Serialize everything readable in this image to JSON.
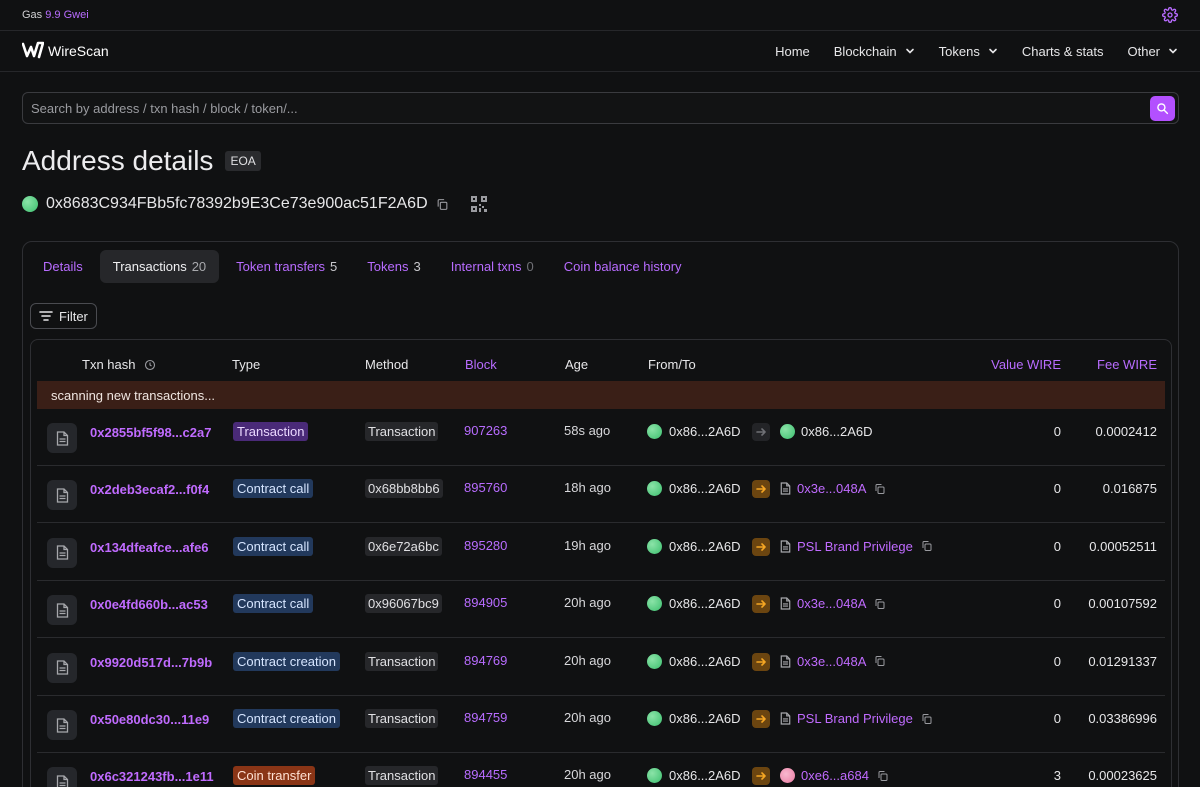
{
  "topbar": {
    "gas_label": "Gas",
    "gas_value": "9.9 Gwei"
  },
  "brand": {
    "name": "WireScan"
  },
  "nav": [
    {
      "label": "Home",
      "dropdown": false
    },
    {
      "label": "Blockchain",
      "dropdown": true
    },
    {
      "label": "Tokens",
      "dropdown": true
    },
    {
      "label": "Charts & stats",
      "dropdown": false
    },
    {
      "label": "Other",
      "dropdown": true
    }
  ],
  "search": {
    "placeholder": "Search by address / txn hash / block / token/..."
  },
  "page": {
    "title": "Address details",
    "badge": "EOA",
    "address": "0x8683C934FBb5fc78392b9E3Ce73e900ac51F2A6D"
  },
  "tabs": [
    {
      "label": "Details",
      "count": ""
    },
    {
      "label": "Transactions",
      "count": "20",
      "active": true
    },
    {
      "label": "Token transfers",
      "count": "5"
    },
    {
      "label": "Tokens",
      "count": "3"
    },
    {
      "label": "Internal txns",
      "count": "0"
    },
    {
      "label": "Coin balance history",
      "count": ""
    }
  ],
  "filter_label": "Filter",
  "table": {
    "headers": {
      "txn_hash": "Txn hash",
      "type": "Type",
      "method": "Method",
      "block": "Block",
      "age": "Age",
      "from_to": "From/To",
      "value": "Value WIRE",
      "fee": "Fee WIRE"
    },
    "scanning_text": "scanning new transactions...",
    "rows": [
      {
        "hash": "0x2855bf5f98...c2a7",
        "type": "Transaction",
        "type_kind": "tx",
        "method": "Transaction",
        "block": "907263",
        "age": "58s ago",
        "from": "0x86...2A6D",
        "direction": "self",
        "to": "0x86...2A6D",
        "to_kind": "avatar",
        "value": "0",
        "fee": "0.0002412"
      },
      {
        "hash": "0x2deb3ecaf2...f0f4",
        "type": "Contract call",
        "type_kind": "cc",
        "method": "0x68bb8bb6",
        "block": "895760",
        "age": "18h ago",
        "from": "0x86...2A6D",
        "direction": "out",
        "to": "0x3e...048A",
        "to_kind": "contract",
        "value": "0",
        "fee": "0.016875"
      },
      {
        "hash": "0x134dfeafce...afe6",
        "type": "Contract call",
        "type_kind": "cc",
        "method": "0x6e72a6bc",
        "block": "895280",
        "age": "19h ago",
        "from": "0x86...2A6D",
        "direction": "out",
        "to": "PSL Brand Privilege",
        "to_kind": "contract",
        "value": "0",
        "fee": "0.00052511"
      },
      {
        "hash": "0x0e4fd660b...ac53",
        "type": "Contract call",
        "type_kind": "cc",
        "method": "0x96067bc9",
        "block": "894905",
        "age": "20h ago",
        "from": "0x86...2A6D",
        "direction": "out",
        "to": "0x3e...048A",
        "to_kind": "contract",
        "value": "0",
        "fee": "0.00107592"
      },
      {
        "hash": "0x9920d517d...7b9b",
        "type": "Contract creation",
        "type_kind": "cc",
        "method": "Transaction",
        "block": "894769",
        "age": "20h ago",
        "from": "0x86...2A6D",
        "direction": "out",
        "to": "0x3e...048A",
        "to_kind": "contract",
        "value": "0",
        "fee": "0.01291337"
      },
      {
        "hash": "0x50e80dc30...11e9",
        "type": "Contract creation",
        "type_kind": "cc",
        "method": "Transaction",
        "block": "894759",
        "age": "20h ago",
        "from": "0x86...2A6D",
        "direction": "out",
        "to": "PSL Brand Privilege",
        "to_kind": "contract",
        "value": "0",
        "fee": "0.03386996"
      },
      {
        "hash": "0x6c321243fb...1e11",
        "type": "Coin transfer",
        "type_kind": "ct",
        "method": "Transaction",
        "block": "894455",
        "age": "20h ago",
        "from": "0x86...2A6D",
        "direction": "out",
        "to": "0xe6...a684",
        "to_kind": "face",
        "value": "3",
        "fee": "0.00023625"
      }
    ]
  },
  "colors": {
    "accent": "#b350ff",
    "link": "#c06bff",
    "background": "#101112"
  }
}
